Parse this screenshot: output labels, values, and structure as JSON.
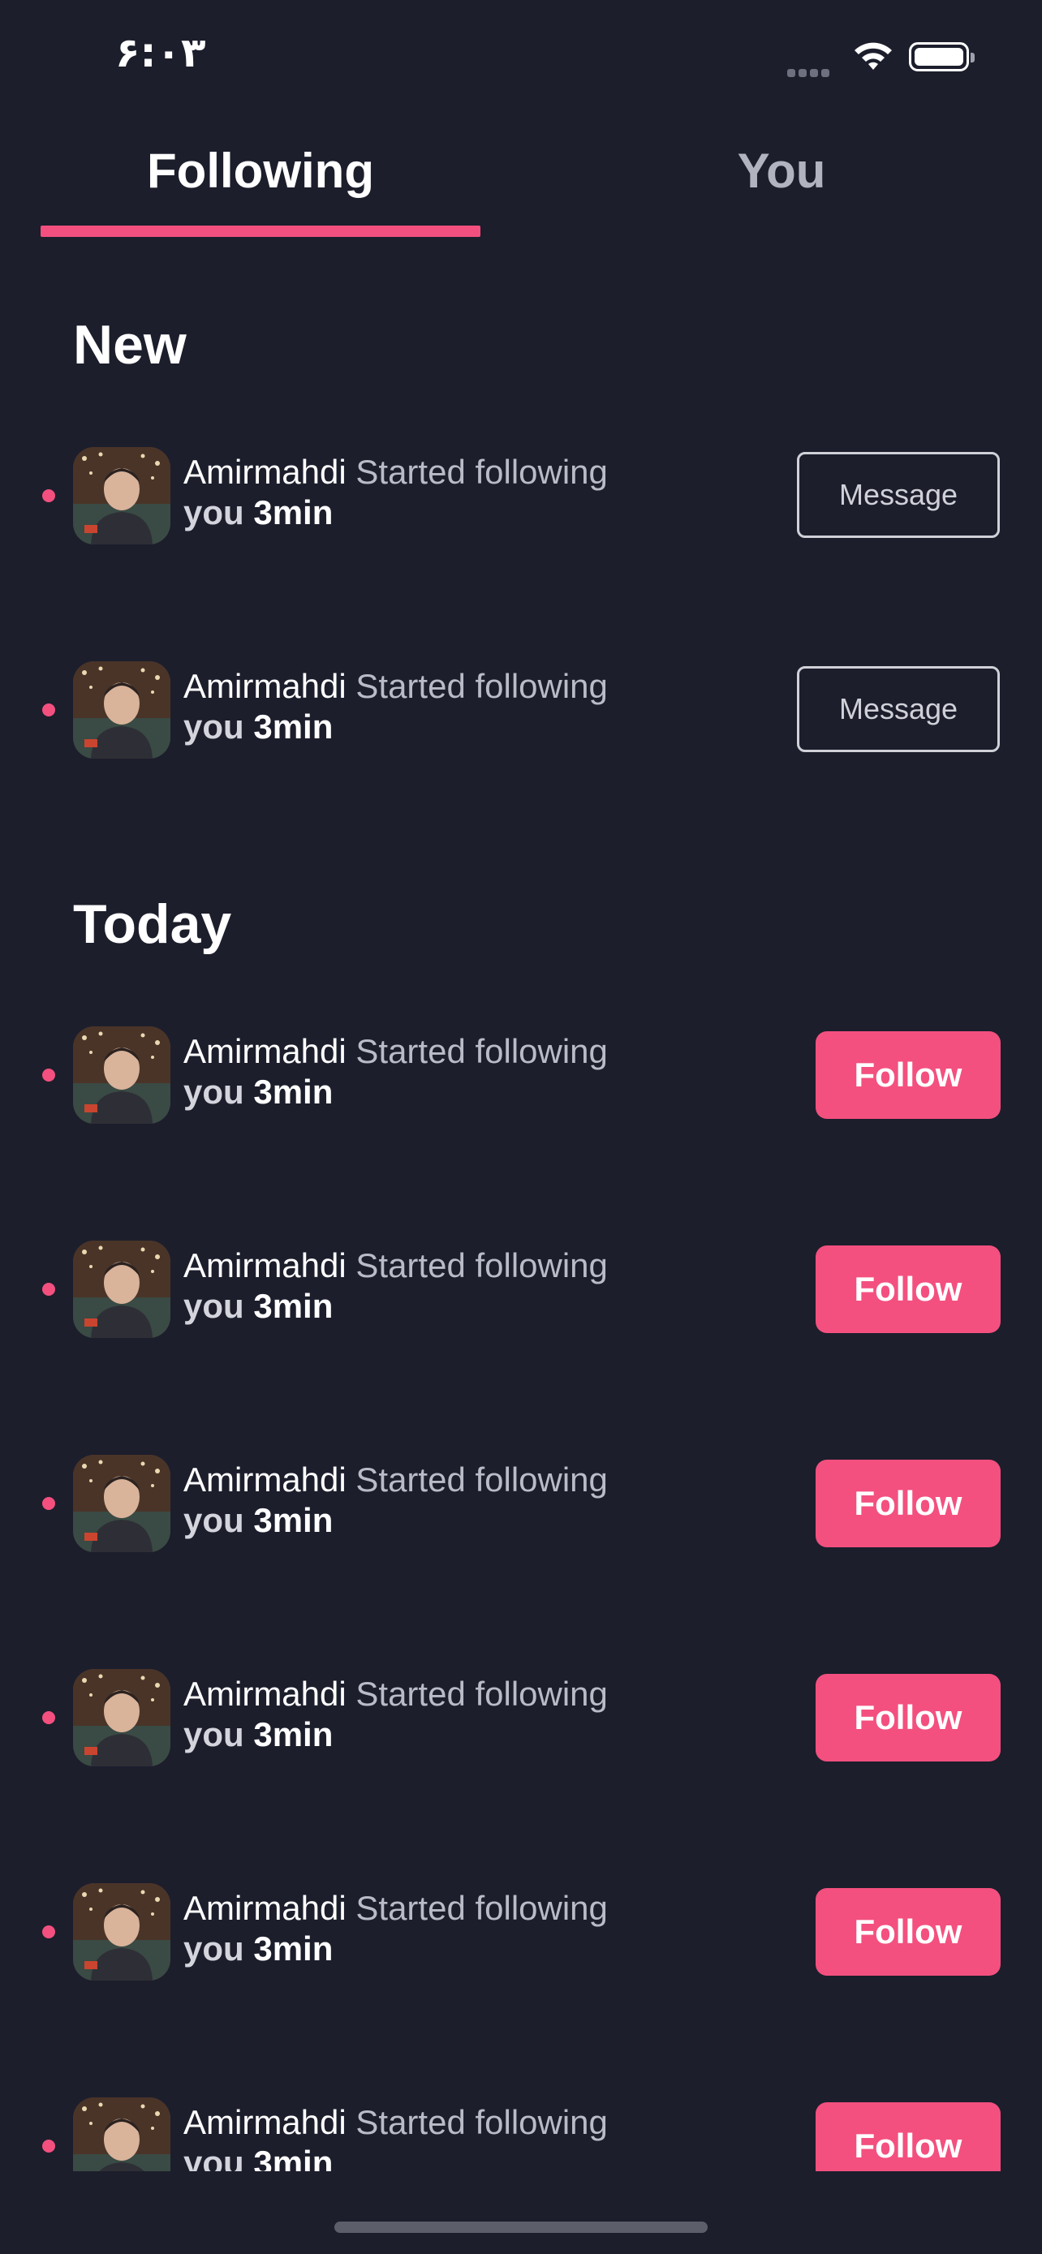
{
  "status_bar": {
    "time": "۶:۰۳"
  },
  "tabs": [
    {
      "label": "Following",
      "active": true
    },
    {
      "label": "You",
      "active": false
    }
  ],
  "accent_color": "#f3507f",
  "background_color": "#1c1e2c",
  "sections": {
    "new": {
      "title": "New",
      "items": [
        {
          "name": "Amirmahdi",
          "action": "Started following",
          "object": "you",
          "time": "3min",
          "button": "Message"
        },
        {
          "name": "Amirmahdi",
          "action": "Started following",
          "object": "you",
          "time": "3min",
          "button": "Message"
        }
      ]
    },
    "today": {
      "title": "Today",
      "items": [
        {
          "name": "Amirmahdi",
          "action": "Started following",
          "object": "you",
          "time": "3min",
          "button": "Follow"
        },
        {
          "name": "Amirmahdi",
          "action": "Started following",
          "object": "you",
          "time": "3min",
          "button": "Follow"
        },
        {
          "name": "Amirmahdi",
          "action": "Started following",
          "object": "you",
          "time": "3min",
          "button": "Follow"
        },
        {
          "name": "Amirmahdi",
          "action": "Started following",
          "object": "you",
          "time": "3min",
          "button": "Follow"
        },
        {
          "name": "Amirmahdi",
          "action": "Started following",
          "object": "you",
          "time": "3min",
          "button": "Follow"
        },
        {
          "name": "Amirmahdi",
          "action": "Started following",
          "object": "you",
          "time": "3min",
          "button": "Follow"
        }
      ]
    }
  },
  "icons": {
    "wifi": "wifi-icon",
    "battery": "battery-icon",
    "signal": "cellular-signal-icon",
    "unread": "unread-dot-icon"
  }
}
